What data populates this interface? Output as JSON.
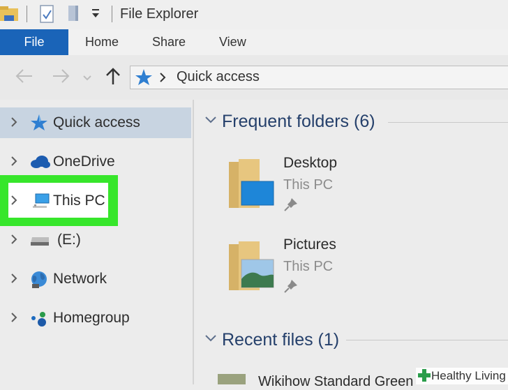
{
  "titlebar": {
    "title": "File Explorer"
  },
  "ribbon": {
    "tabs": [
      "File",
      "Home",
      "Share",
      "View"
    ]
  },
  "address": {
    "path": "Quick access"
  },
  "nav": {
    "items": [
      {
        "label": "Quick access",
        "icon": "star-icon"
      },
      {
        "label": "OneDrive",
        "icon": "cloud-icon"
      },
      {
        "label": "This PC",
        "icon": "computer-icon"
      },
      {
        "label": "(E:)",
        "icon": "drive-icon"
      },
      {
        "label": "Network",
        "icon": "network-icon"
      },
      {
        "label": "Homegroup",
        "icon": "homegroup-icon"
      }
    ]
  },
  "content": {
    "frequent_title": "Frequent folders (6)",
    "recent_title": "Recent files (1)",
    "folders": [
      {
        "name": "Desktop",
        "location": "This PC"
      },
      {
        "name": "Pictures",
        "location": "This PC"
      }
    ],
    "recent_file": "Wikihow Standard Green"
  },
  "watermark": {
    "text": "Healthy Living"
  },
  "colors": {
    "file_tab": "#1a64b8",
    "highlight": "#37e62b",
    "selected": "#c8d4e1",
    "group_title": "#25406b"
  }
}
